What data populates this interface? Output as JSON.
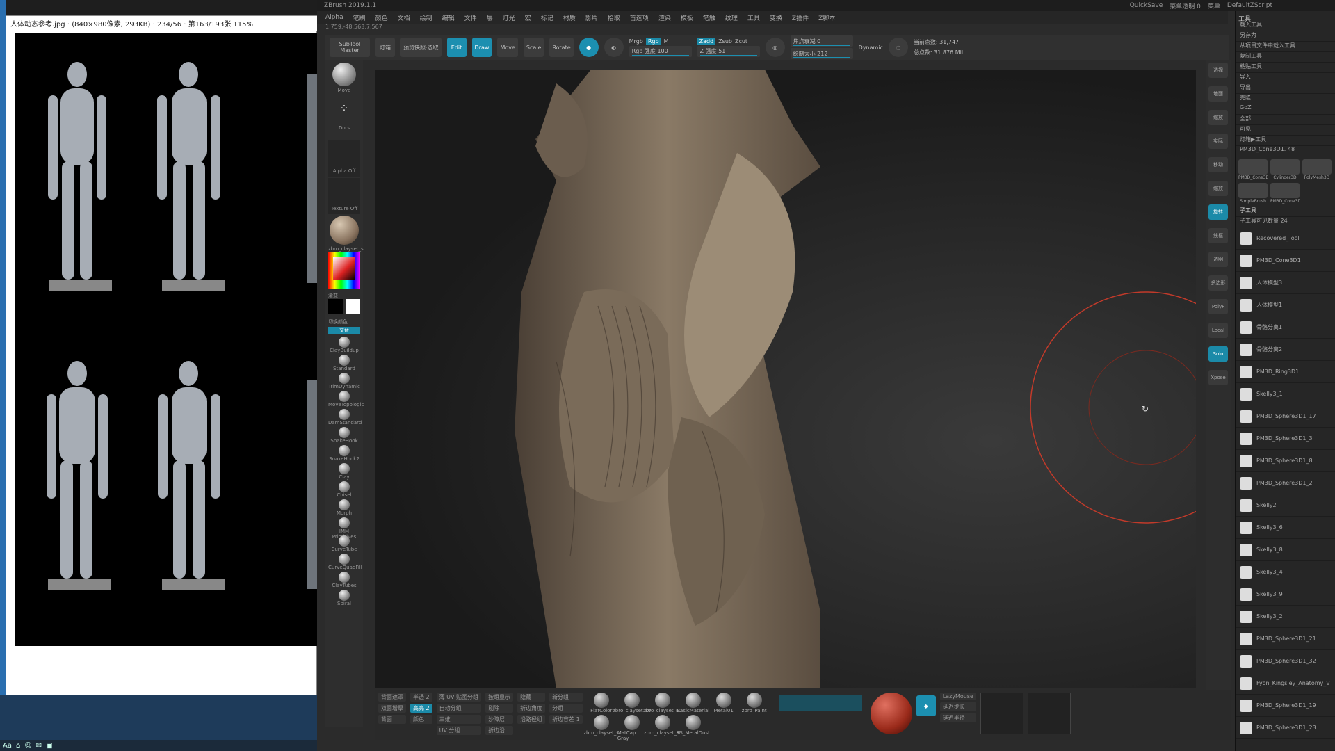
{
  "viewer": {
    "title": "人体动态参考.jpg · (840×980像素, 293KB) · 234/56 · 第163/193张 115%"
  },
  "taskbar": {
    "items": [
      "Aa",
      "⌂",
      "☺",
      "✉",
      "▣"
    ]
  },
  "zbrush": {
    "title": "ZBrush 2019.1.1",
    "right_title": [
      "QuickSave",
      "菜单透明 0",
      "菜单",
      "DefaultZScript"
    ],
    "menu": [
      "Alpha",
      "笔刷",
      "颜色",
      "文档",
      "绘制",
      "编辑",
      "文件",
      "层",
      "灯光",
      "宏",
      "标记",
      "材质",
      "影片",
      "拾取",
      "首选项",
      "渲染",
      "模板",
      "笔触",
      "纹理",
      "工具",
      "变换",
      "Z插件",
      "Z脚本"
    ],
    "coord": "1.759,-48.563,7.567",
    "top_buttons": {
      "subtool_master": "SubTool Master",
      "light": "灯箱",
      "quick": "预览快照·选取",
      "edit": "Edit",
      "draw": "Draw",
      "move": "Move",
      "scale": "Scale",
      "rotate": "Rotate"
    },
    "sliders": {
      "mrgb": "Mrgb",
      "rgb": "Rgb",
      "m": "M",
      "zadd": "Zadd",
      "zsub": "Zsub",
      "zcut": "Zcut",
      "rgb_intensity": "Rgb 强度 100",
      "z_intensity": "Z 强度 51",
      "focal": "焦点衰减 0",
      "draw_size": "绘制大小 212",
      "dynamic": "Dynamic",
      "active_points": "当前点数: 31,747",
      "total_points": "总点数: 31.876 Mil"
    },
    "left_shelf": {
      "move": "Move",
      "dots": "Dots",
      "alpha_off": "Alpha Off",
      "texture_off": "Texture Off",
      "material": "zbro_clayset_s",
      "gradient": "渐变",
      "switch_color": "切换颜色",
      "alternate": "交替",
      "brushes": [
        "ClayBuildup",
        "Standard",
        "TrimDynamic",
        "MoveTopologic",
        "DamStandard",
        "SnakeHook",
        "SnakeHook2",
        "Clay",
        "Chisel",
        "Morph",
        "IMM Primitives",
        "CurveTube",
        "CurveQuadFill",
        "ClayTubes",
        "Spiral"
      ]
    },
    "right_shelf": [
      "透视",
      "地面",
      "缩放",
      "实际",
      "移动",
      "缩放",
      "旋转",
      "线框",
      "透明",
      "多边形",
      "PolyF",
      "Local",
      "Solo",
      "Xpose"
    ],
    "tray": {
      "header": "工具",
      "rows": [
        "载入工具",
        "另存为",
        "从项目文件中载入工具",
        "复制工具",
        "粘贴工具",
        "导入",
        "导出",
        "克隆",
        "GoZ",
        "全部",
        "可见",
        "灯箱▶工具",
        "PM3D_Cone3D1. 48"
      ],
      "tools": [
        "PM3D_Cone3D1",
        "Cylinder3D",
        "PolyMesh3D",
        "SimpleBrush",
        "PM3D_Cone3D"
      ],
      "subtool_header": "子工具",
      "subtool_count": "子工具可见数量 24",
      "subtools": [
        "Recovered_Tool",
        "PM3D_Cone3D1",
        "人体模型3",
        "人体模型1",
        "骨骼分离1",
        "骨骼分离2",
        "PM3D_Ring3D1",
        "Skelly3_1",
        "PM3D_Sphere3D1_17",
        "PM3D_Sphere3D1_3",
        "PM3D_Sphere3D1_8",
        "PM3D_Sphere3D1_2",
        "Skelly2",
        "Skelly3_6",
        "Skelly3_8",
        "Skelly3_4",
        "Skelly3_9",
        "Skelly3_2",
        "PM3D_Sphere3D1_21",
        "PM3D_Sphere3D1_32",
        "Fyon_Kingsley_Anatomy_V",
        "PM3D_Sphere3D1_19",
        "PM3D_Sphere3D1_23"
      ]
    },
    "bottom": {
      "col1": [
        "背面遮罩",
        "双面增厚",
        "背面"
      ],
      "col2": [
        "半透 2",
        "高亮 2",
        "颜色"
      ],
      "col3": [
        "薄 UV 贴图分组",
        "自动分组",
        "三维",
        "UV 分组"
      ],
      "col4": [
        "按组显示",
        "剔除",
        "沙障层",
        "折边沿"
      ],
      "col5": [
        "隐藏",
        "折边角度",
        "沿路径组"
      ],
      "col6": [
        "新分组",
        "分组",
        "折边容差 1"
      ],
      "materials": [
        "FlatColor",
        "zbro_clayset_s0",
        "zbro_clayset_s0",
        "BasicMaterial",
        "Metal01",
        "zbro_Paint",
        "zbro_clayset_s",
        "MatCap Gray",
        "zbro_clayset_st",
        "RS_MetalDust"
      ],
      "lazy": "LazyMouse",
      "lazy2": "延迟步长",
      "lazy3": "延迟半径"
    }
  }
}
